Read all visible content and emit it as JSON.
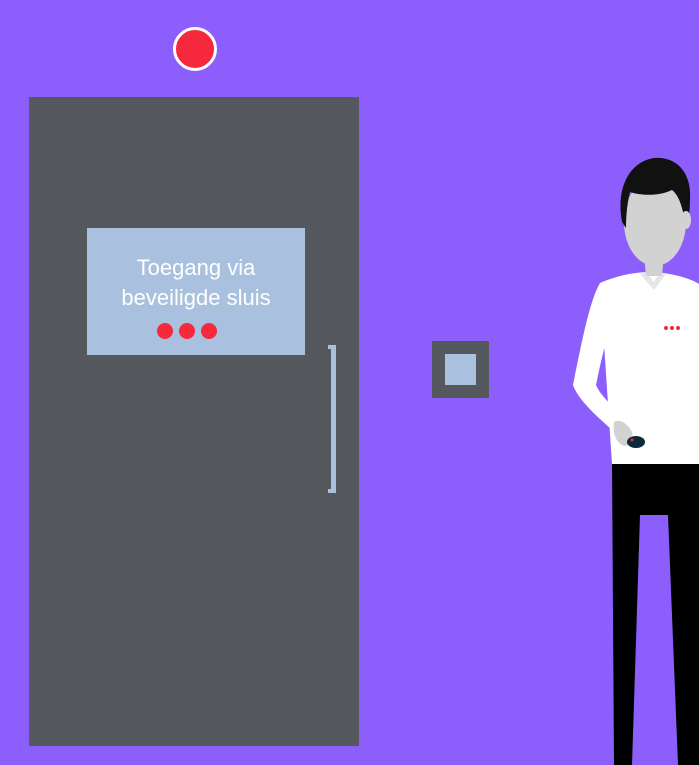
{
  "scene": {
    "background_color": "#8c5ffc",
    "alarm_light": {
      "icon": "alarm-light-icon",
      "color": "#f5283c"
    },
    "door": {
      "color": "#55585d",
      "sign": {
        "line1": "Toegang via",
        "line2": "beveiligde sluis",
        "background_color": "#a9c1de",
        "dot_color": "#f5283c",
        "dot_count": 3
      },
      "handle_color": "#a9c1de"
    },
    "card_reader": {
      "icon": "card-reader-icon",
      "frame_color": "#55585d",
      "panel_color": "#a9c1de"
    },
    "person": {
      "icon": "security-guard-icon",
      "shirt_color": "#ffffff",
      "pants_color": "#000000",
      "skin_color": "#d2d2d2",
      "hair_color": "#111111",
      "badge_color": "#f5283c"
    }
  }
}
